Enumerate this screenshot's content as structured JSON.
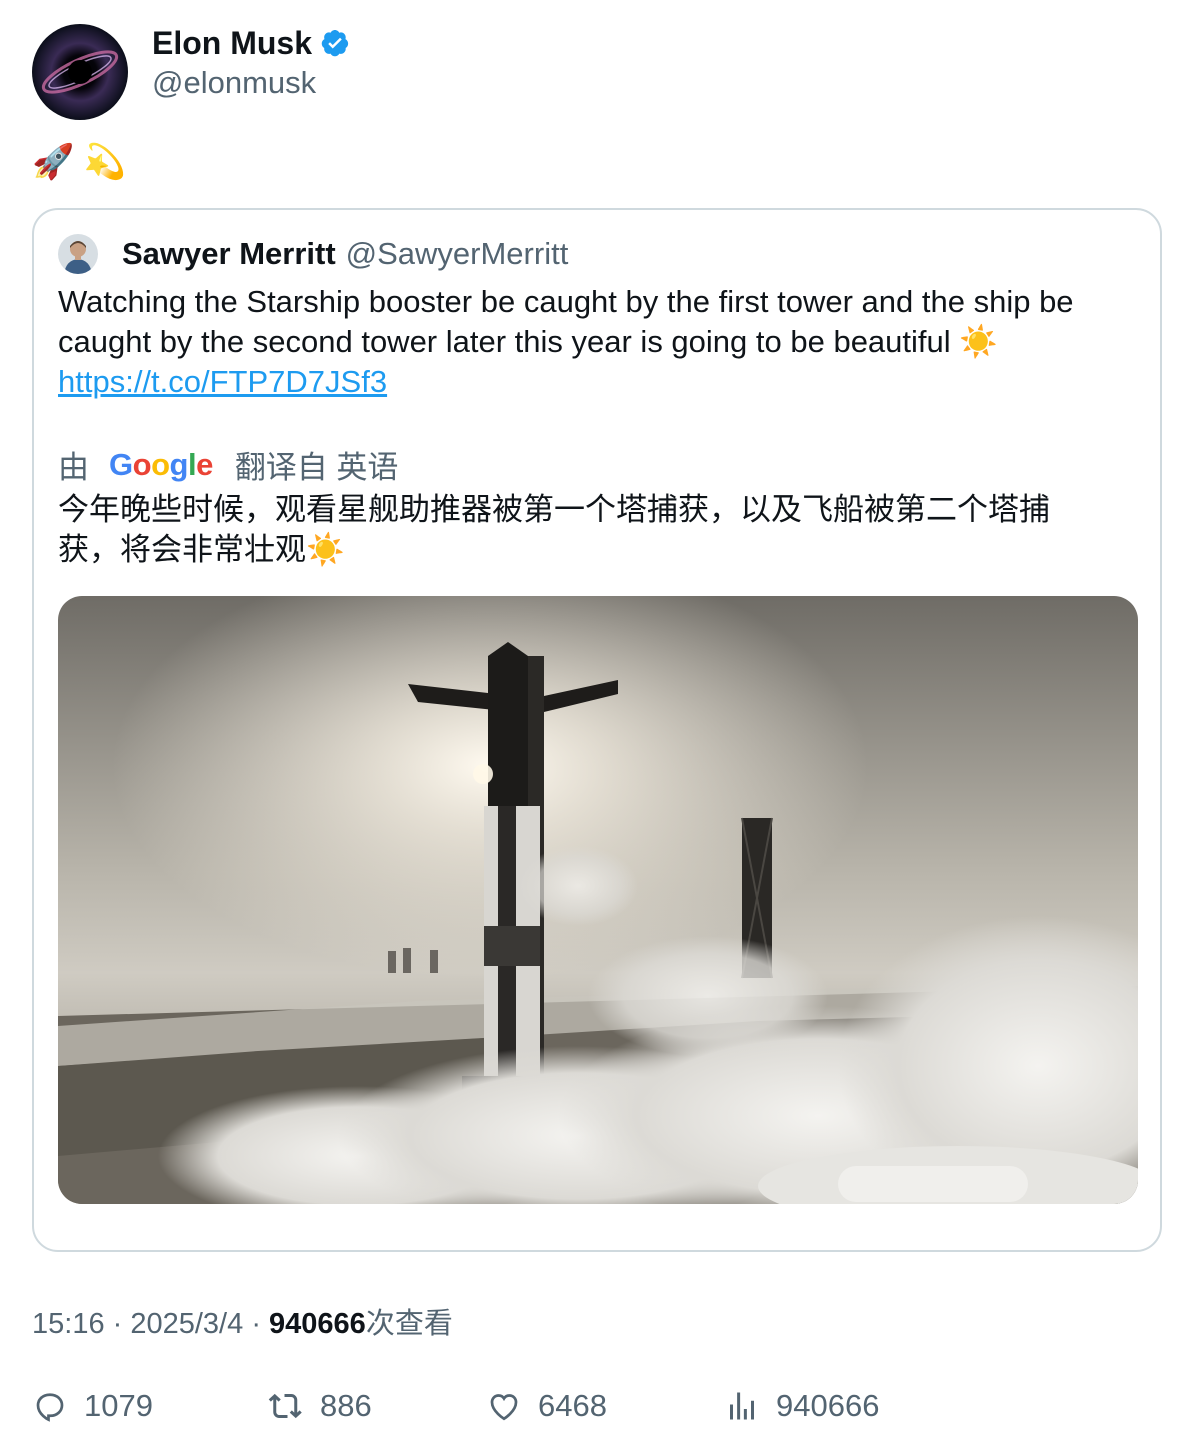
{
  "tweet": {
    "author": {
      "display_name": "Elon Musk",
      "handle": "@elonmusk",
      "verified": true
    },
    "text": "🚀 💫",
    "quoted": {
      "author": {
        "display_name": "Sawyer Merritt",
        "handle": "@SawyerMerritt"
      },
      "text": "Watching the Starship booster be caught by the first tower and the ship be caught by the second tower later this year is going to be beautiful ☀️",
      "link": "https://t.co/FTP7D7JSf3",
      "translation": {
        "by_label": "由",
        "google_letters": [
          "G",
          "o",
          "o",
          "g",
          "l",
          "e"
        ],
        "from_label": "翻译自 英语",
        "text": "今年晚些时候，观看星舰助推器被第一个塔捕获，以及飞船被第二个塔捕获，将会非常壮观☀️"
      }
    },
    "meta": {
      "time": "15:16",
      "date": "2025/3/4",
      "views": "940666",
      "views_suffix": "次查看"
    },
    "actions": {
      "replies": "1079",
      "retweets": "886",
      "likes": "6468",
      "views": "940666"
    }
  },
  "icons": [
    "verified-badge-icon",
    "reply-icon",
    "retweet-icon",
    "like-icon",
    "views-icon"
  ],
  "colors": {
    "link": "#1d9bf0",
    "secondary_text": "#536471",
    "verified": "#1d9bf0",
    "border": "#cfd9de"
  }
}
